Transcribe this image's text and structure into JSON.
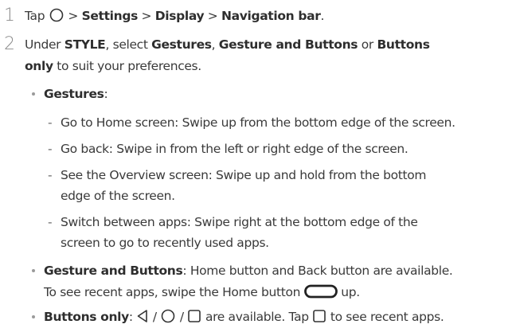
{
  "steps": [
    {
      "number": "1",
      "tap": "Tap",
      "sep1": " > ",
      "settings": "Settings",
      "sep2": " > ",
      "display": "Display",
      "sep3": " > ",
      "navbar": "Navigation bar",
      "end": "."
    },
    {
      "number": "2",
      "under": "Under ",
      "style": "STYLE",
      "select": ", select ",
      "gestures": "Gestures",
      "comma": ", ",
      "gesture_buttons": "Gesture and Buttons",
      "or": " or ",
      "buttons_only_a": "Buttons",
      "buttons_only_b": "only",
      "suit": " to suit your preferences."
    }
  ],
  "options": {
    "gestures": {
      "label": "Gestures",
      "colon": ":",
      "items": [
        [
          "Go to Home screen: Swipe up from the bottom edge of the screen."
        ],
        [
          "Go back: Swipe in from the left or right edge of the screen."
        ],
        [
          "See the Overview screen: Swipe up and hold from the bottom",
          "edge of the screen."
        ],
        [
          "Switch between apps: Swipe right at the bottom edge of the",
          "screen to go to recently used apps."
        ]
      ]
    },
    "gesture_buttons": {
      "label": "Gesture and Buttons",
      "text1": ": Home button and Back button are available.",
      "text2a": "To see recent apps, swipe the Home button ",
      "text2b": " up."
    },
    "buttons_only": {
      "label": "Buttons only",
      "colon": ": ",
      "slash1": " / ",
      "slash2": " / ",
      "available": " are available. Tap ",
      "recent": " to see recent apps."
    }
  },
  "icons": [
    "home-circle-icon",
    "back-triangle-icon",
    "recent-square-icon",
    "home-pill-icon"
  ],
  "colors": {
    "text": "#3a3a3a",
    "bold": "#2e2e2e",
    "number": "#8a8a8a"
  }
}
